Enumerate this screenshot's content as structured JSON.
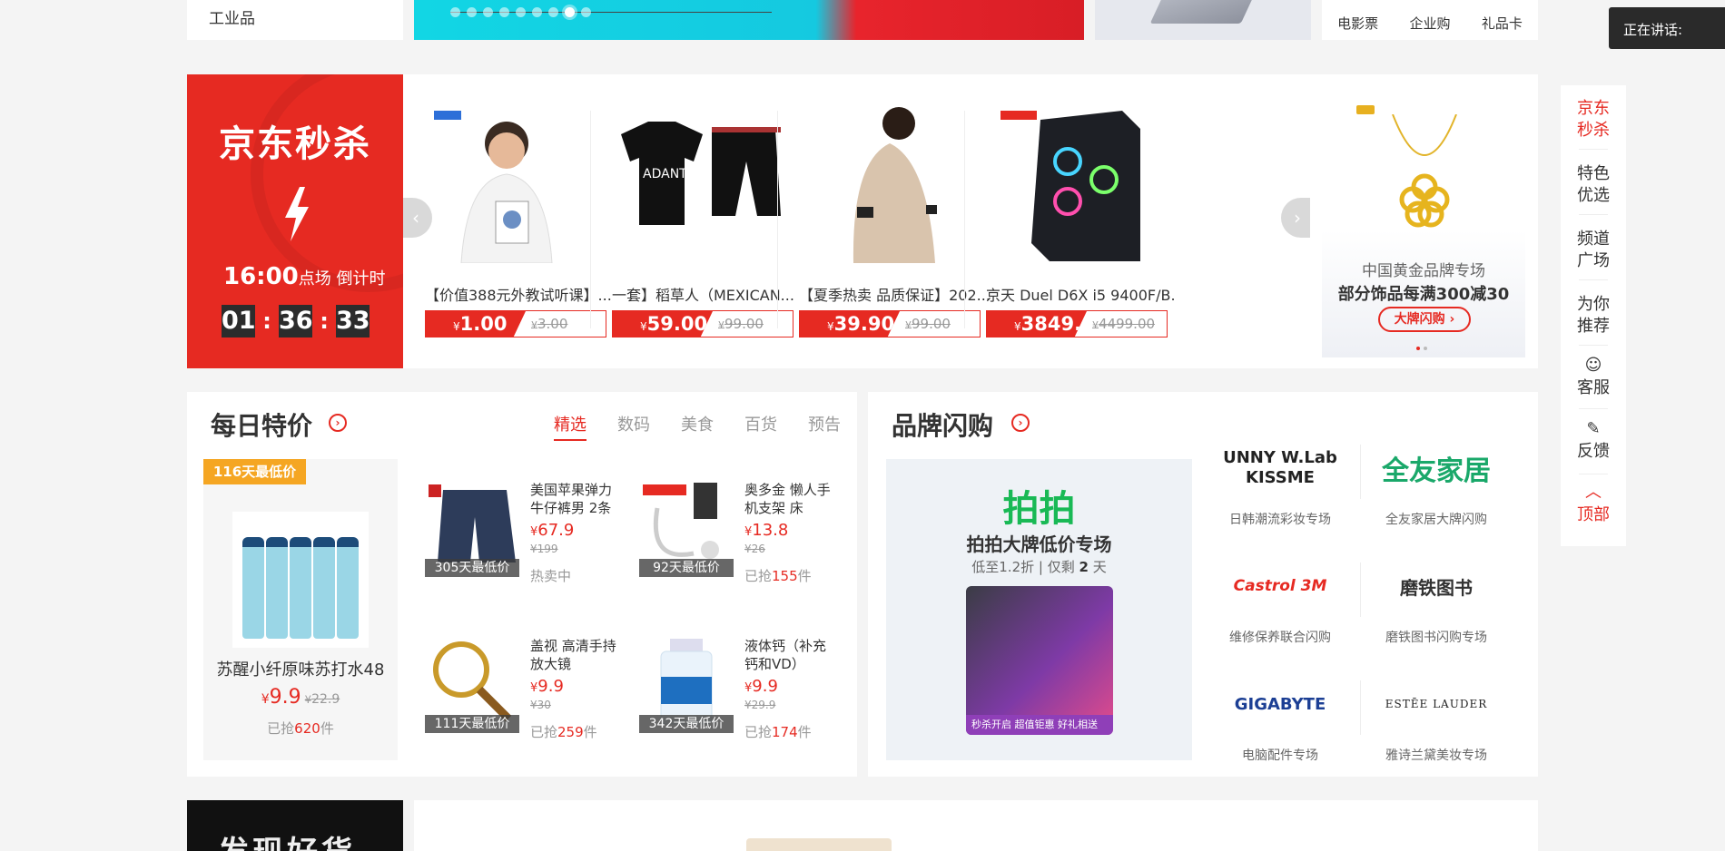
{
  "top": {
    "category_item": "工业品",
    "links": [
      "电影票",
      "企业购",
      "礼品卡"
    ],
    "speaking_label": "正在讲话:"
  },
  "seckill": {
    "title": "京东秒杀",
    "session_time": "16:00",
    "session_text": "点场 倒计时",
    "countdown": {
      "h": "01",
      "m": "36",
      "s": "33"
    },
    "items": [
      {
        "name": "【价值388元外教试听课】...",
        "price": "1.00",
        "old_price": "3.00"
      },
      {
        "name": "一套】稻草人（MEXICAN...",
        "price": "59.00",
        "old_price": "99.00"
      },
      {
        "name": "【夏季热卖 品质保证】202...",
        "price": "39.90",
        "old_price": "99.00"
      },
      {
        "name": "京天 Duel D6X i5 9400F/B...",
        "price": "3849.00",
        "old_price": "4499.00"
      }
    ],
    "currency": "¥",
    "gold_promo": {
      "line1": "中国黄金品牌专场",
      "line2": "部分饰品每满300减30",
      "button": "大牌闪购 ›"
    }
  },
  "toolbar": {
    "items": [
      "京东秒杀",
      "特色优选",
      "频道广场",
      "为你推荐",
      "客服",
      "反馈",
      "顶部"
    ]
  },
  "daily": {
    "title": "每日特价",
    "tabs": [
      "精选",
      "数码",
      "美食",
      "百货",
      "预告"
    ],
    "featured": {
      "badge": "116天最低价",
      "name": "苏醒小纤原味苏打水48",
      "price": "9.9",
      "old_price": "22.9",
      "sold_prefix": "已抢",
      "sold_count": "620",
      "sold_suffix": "件"
    },
    "deals": [
      {
        "tag": "305天最低价",
        "name": "美国苹果弹力牛仔裤男 2条",
        "price": "67.9",
        "old_price": "¥199",
        "status": "热卖中"
      },
      {
        "tag": "92天最低价",
        "name": "奥多金 懒人手机支架 床",
        "price": "13.8",
        "old_price": "¥26",
        "sold_prefix": "已抢",
        "sold_count": "155",
        "sold_suffix": "件"
      },
      {
        "tag": "111天最低价",
        "name": "盖视 高清手持放大镜",
        "price": "9.9",
        "old_price": "¥30",
        "sold_prefix": "已抢",
        "sold_count": "259",
        "sold_suffix": "件"
      },
      {
        "tag": "342天最低价",
        "name": "液体钙（补充钙和VD）",
        "price": "9.9",
        "old_price": "¥29.9",
        "sold_prefix": "已抢",
        "sold_count": "174",
        "sold_suffix": "件"
      }
    ]
  },
  "brand": {
    "title": "品牌闪购",
    "paipai": {
      "logo": "拍拍",
      "title": "拍拍大牌低价专场",
      "sub_prefix": "低至1.2折 | 仅剩",
      "days": "2",
      "sub_suffix": "天",
      "strip": "秒杀开启   超值钜惠  好礼相送"
    },
    "cells": [
      {
        "logo": "UNNY W.Lab KISSME",
        "caption": "日韩潮流彩妆专场"
      },
      {
        "logo": "全友家居",
        "caption": "全友家居大牌闪购"
      },
      {
        "logo": "Castrol 3M",
        "caption": "维修保养联合闪购"
      },
      {
        "logo": "磨铁图书",
        "caption": "磨铁图书闪购专场"
      },
      {
        "logo": "GIGABYTE",
        "caption": "电脑配件专场"
      },
      {
        "logo": "ESTĒE LAUDER",
        "caption": "雅诗兰黛美妆专场"
      }
    ]
  },
  "bottom": {
    "dark_text": "发现好货"
  },
  "colors": {
    "accent": "#e62a22",
    "badge": "#f5a623",
    "paipai_green": "#19b955"
  }
}
